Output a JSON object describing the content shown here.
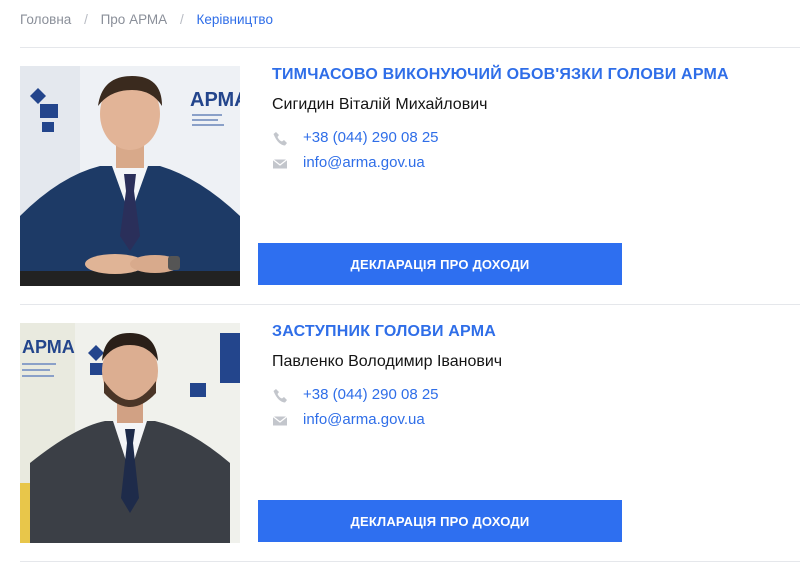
{
  "breadcrumb": {
    "items": [
      "Головна",
      "Про АРМА"
    ],
    "separator": "/",
    "current": "Керівництво"
  },
  "people": [
    {
      "role": "ТИМЧАСОВО ВИКОНУЮЧИЙ ОБОВ'ЯЗКИ ГОЛОВИ АРМА",
      "name": "Сигидин Віталій Михайлович",
      "phone": "+38 (044) 290 08 25",
      "email": "info@arma.gov.ua",
      "button": "ДЕКЛАРАЦІЯ ПРО ДОХОДИ"
    },
    {
      "role": "ЗАСТУПНИК ГОЛОВИ АРМА",
      "name": "Павленко Володимир Іванович",
      "phone": "+38 (044) 290 08 25",
      "email": "info@arma.gov.ua",
      "button": "ДЕКЛАРАЦІЯ ПРО ДОХОДИ"
    }
  ],
  "photo_logo_text": "АРМА",
  "colors": {
    "accent": "#2f6ee8",
    "button": "#2e6ff0",
    "muted": "#8a8f99",
    "icon": "#c3c6cc"
  }
}
